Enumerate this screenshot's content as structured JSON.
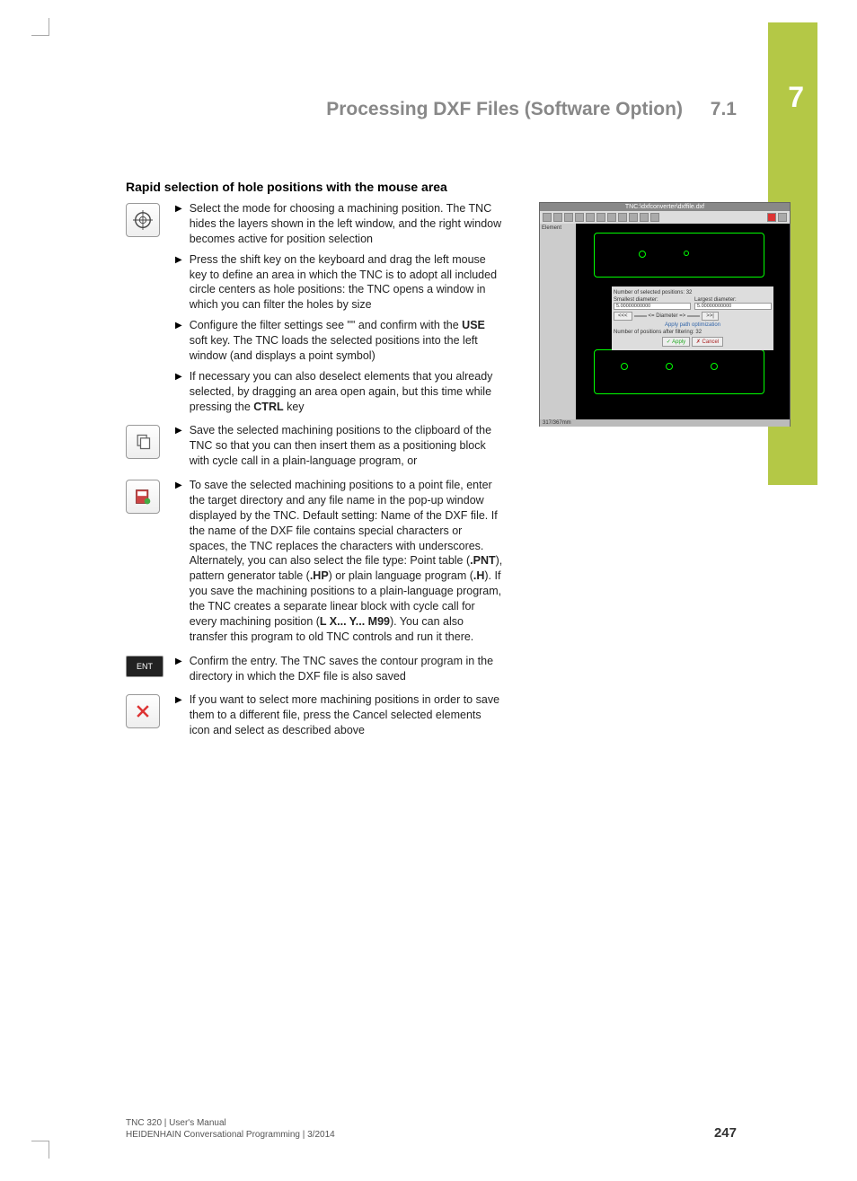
{
  "chapter": "7",
  "header": {
    "title": "Processing DXF Files (Software Option)",
    "section": "7.1"
  },
  "section_title": "Rapid selection of hole positions with the mouse area",
  "steps": [
    {
      "icon": "crosshair",
      "text": "Select the mode for choosing a machining position. The TNC hides the layers shown in the left window, and the right window becomes active for position selection"
    },
    {
      "icon": "",
      "text": "Press the shift key on the keyboard and drag the left mouse key to define an area in which the TNC is to adopt all included circle centers as hole positions: the TNC opens a window in which you can filter the holes by size"
    },
    {
      "icon": "",
      "text_parts": [
        "Configure the filter settings see \"\" and confirm with the ",
        "USE",
        " soft key. The TNC loads the selected positions into the left window (and displays a point symbol)"
      ]
    },
    {
      "icon": "",
      "text_parts": [
        "If necessary you can also deselect elements that you already selected, by dragging an area open again, but this time while pressing the ",
        "CTRL",
        " key"
      ]
    },
    {
      "icon": "clipboard",
      "text": "Save the selected machining positions to the clipboard of the TNC so that you can then insert them as a positioning block with cycle call in a plain-language program, or"
    },
    {
      "icon": "savefile",
      "text_parts": [
        "To save the selected machining positions to a point file, enter the target directory and any file name in the pop-up window displayed by the TNC. Default setting: Name of the DXF file. If the name of the DXF file contains special characters or spaces, the TNC replaces the characters with underscores. Alternately, you can also select the file type: Point table (",
        ".PNT",
        "), pattern generator table (",
        ".HP",
        ") or plain language program (",
        ".H",
        "). If you save the machining positions to a plain-language program, the TNC creates a separate linear block with cycle call for every machining position (",
        "L X... Y... M99",
        "). You can also transfer this program to old TNC controls and run it there."
      ]
    },
    {
      "icon": "ent",
      "text": "Confirm the entry. The TNC saves the contour program in the directory in which the DXF file is also saved"
    },
    {
      "icon": "cancel-x",
      "text": "If you want to select more machining positions in order to save them to a different file, press the Cancel selected elements icon and select as described above"
    }
  ],
  "screenshot": {
    "title_path": "TNC:\\dxfconverter\\dxffile.dxf",
    "side_panel": "Element",
    "dialog": {
      "selected_label": "Number of selected positions: 32",
      "smallest": "Smallest diameter:",
      "smallest_val": "5.00000000000",
      "largest": "Largest diameter:",
      "largest_val": "5.00000000000",
      "range_left": "<<<",
      "range_mid": "<= Diameter =>",
      "range_right": ">>|",
      "apply": "Apply path optimization",
      "after": "Number of positions after filtering: 32",
      "btn_apply": "Apply",
      "btn_cancel": "Cancel"
    },
    "status": "317/367mm"
  },
  "footer": {
    "line1": "TNC 320 | User's Manual",
    "line2": "HEIDENHAIN Conversational Programming | 3/2014",
    "page": "247"
  }
}
